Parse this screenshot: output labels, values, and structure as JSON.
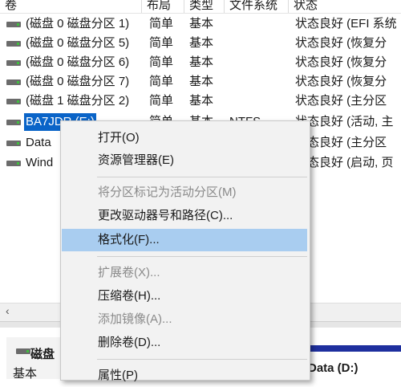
{
  "columns": [
    "卷",
    "布局",
    "类型",
    "文件系统",
    "状态"
  ],
  "rows": [
    {
      "volume": "(磁盘 0 磁盘分区 1)",
      "layout": "简单",
      "type": "基本",
      "fs": "",
      "status": "状态良好 (EFI 系统"
    },
    {
      "volume": "(磁盘 0 磁盘分区 5)",
      "layout": "简单",
      "type": "基本",
      "fs": "",
      "status": "状态良好 (恢复分"
    },
    {
      "volume": "(磁盘 0 磁盘分区 6)",
      "layout": "简单",
      "type": "基本",
      "fs": "",
      "status": "状态良好 (恢复分"
    },
    {
      "volume": "(磁盘 0 磁盘分区 7)",
      "layout": "简单",
      "type": "基本",
      "fs": "",
      "status": "状态良好 (恢复分"
    },
    {
      "volume": "(磁盘 1 磁盘分区 2)",
      "layout": "简单",
      "type": "基本",
      "fs": "",
      "status": "状态良好 (主分区"
    },
    {
      "volume": "BA7JDR (E:)",
      "layout": "简单",
      "type": "基本",
      "fs": "NTFS",
      "status": "状态良好 (活动, 主"
    },
    {
      "volume": "Data",
      "layout": "",
      "type": "",
      "fs": "",
      "status": "状态良好 (主分区"
    },
    {
      "volume": "Wind",
      "layout": "",
      "type": "",
      "fs": "",
      "status": "状态良好 (启动, 页"
    }
  ],
  "bottom": {
    "disk_label": "磁盘",
    "disk_type": "基本",
    "volume_label": "Data  (D:)"
  },
  "context_menu": {
    "items": [
      {
        "label": "打开(O)",
        "disabled": false
      },
      {
        "label": "资源管理器(E)",
        "disabled": false
      },
      {
        "label": "将分区标记为活动分区(M)",
        "disabled": true
      },
      {
        "label": "更改驱动器号和路径(C)...",
        "disabled": false
      },
      {
        "label": "格式化(F)...",
        "disabled": false,
        "highlighted": true
      },
      {
        "label": "扩展卷(X)...",
        "disabled": true
      },
      {
        "label": "压缩卷(H)...",
        "disabled": false
      },
      {
        "label": "添加镜像(A)...",
        "disabled": true
      },
      {
        "label": "删除卷(D)...",
        "disabled": false
      },
      {
        "label": "属性(P)",
        "disabled": false
      }
    ]
  },
  "colors": {
    "selection": "#0a64c8",
    "menu_highlight": "#a9cdf0",
    "disk_bar": "#1e2f9e"
  },
  "icons": {
    "volume": "disk-drive-icon",
    "scroll_left": "chevron-left-icon"
  }
}
